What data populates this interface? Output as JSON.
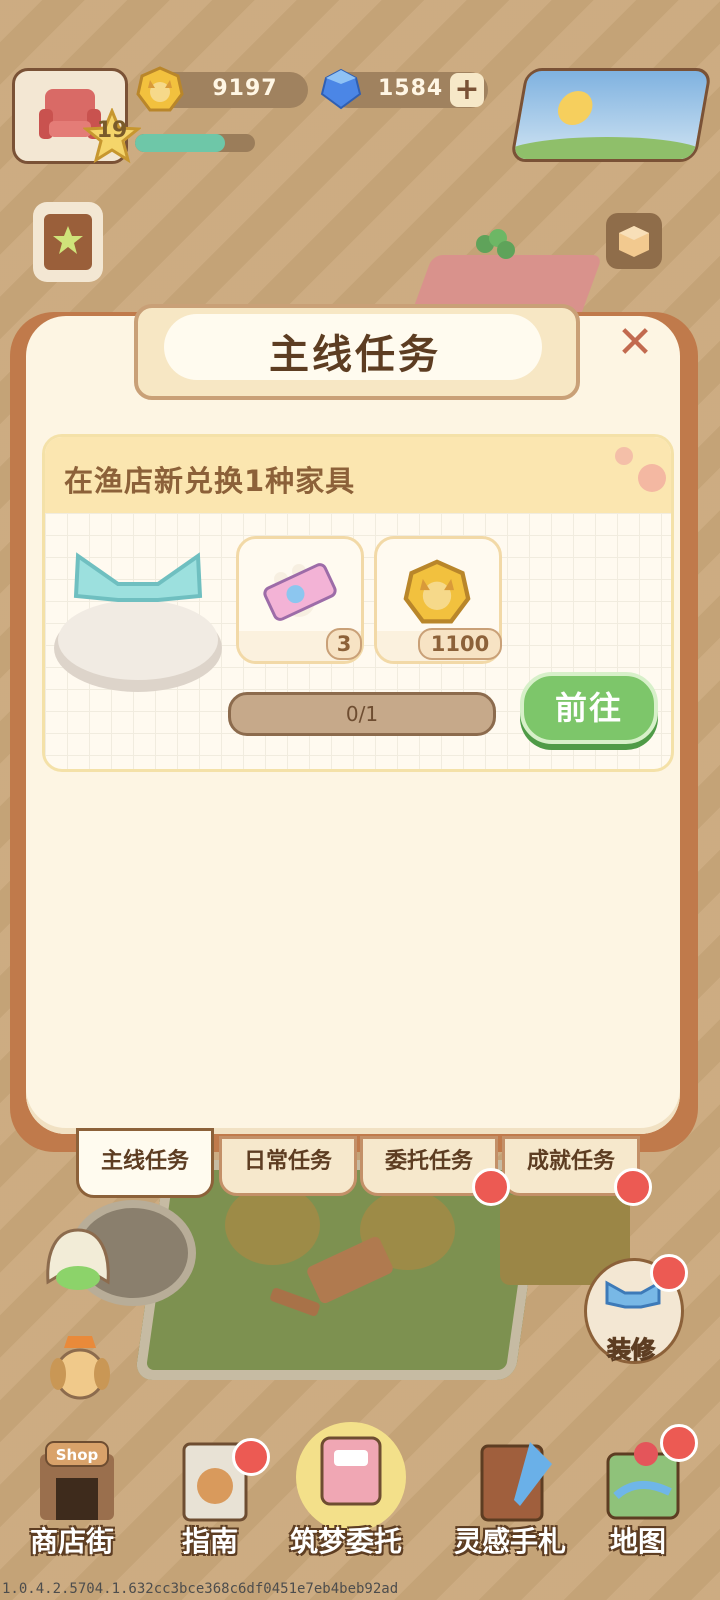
{
  "hud": {
    "level": "19",
    "xp_progress": 0.75,
    "coins": "9197",
    "gems": "1584",
    "add_gems_label": "+"
  },
  "dialog": {
    "title": "主线任务",
    "close_label": "✕"
  },
  "task": {
    "description": "在渔店新兑换1种家具",
    "rewards": [
      {
        "name": "ticket-icon",
        "count": "3"
      },
      {
        "name": "corgi-coin-icon",
        "count": "1100"
      }
    ],
    "progress_text": "0/1",
    "progress_fraction": 0,
    "go_label": "前往"
  },
  "tabs": [
    {
      "label": "主线任务",
      "active": true,
      "badge": false
    },
    {
      "label": "日常任务",
      "active": false,
      "badge": false
    },
    {
      "label": "委托任务",
      "active": false,
      "badge": true
    },
    {
      "label": "成就任务",
      "active": false,
      "badge": true
    }
  ],
  "side": {
    "renovate_label": "装修"
  },
  "nav": [
    {
      "label": "商店街",
      "icon": "shop-icon",
      "badge": false,
      "sign": "Shop"
    },
    {
      "label": "指南",
      "icon": "guide-icon",
      "badge": true
    },
    {
      "label": "筑梦委托",
      "icon": "notebook-icon",
      "badge": false
    },
    {
      "label": "灵感手札",
      "icon": "journal-icon",
      "badge": false
    },
    {
      "label": "地图",
      "icon": "map-icon",
      "badge": true
    }
  ],
  "version": "1.0.4.2.5704.1.632cc3bce368c6df0451e7eb4beb92ad",
  "colors": {
    "accent_green": "#7dc66a",
    "badge_red": "#ec5a53",
    "title_brown": "#5d3d22"
  }
}
